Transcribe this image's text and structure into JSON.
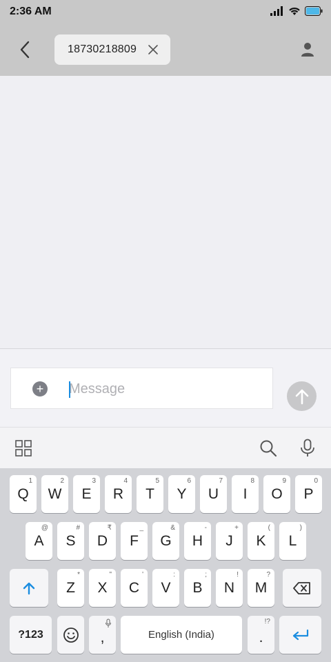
{
  "status_bar": {
    "time": "2:36 AM"
  },
  "header": {
    "recipient": "18730218809"
  },
  "composer": {
    "placeholder": "Message",
    "value": ""
  },
  "keyboard": {
    "row1": [
      {
        "key": "Q",
        "hint": "1"
      },
      {
        "key": "W",
        "hint": "2"
      },
      {
        "key": "E",
        "hint": "3"
      },
      {
        "key": "R",
        "hint": "4"
      },
      {
        "key": "T",
        "hint": "5"
      },
      {
        "key": "Y",
        "hint": "6"
      },
      {
        "key": "U",
        "hint": "7"
      },
      {
        "key": "I",
        "hint": "8"
      },
      {
        "key": "O",
        "hint": "9"
      },
      {
        "key": "P",
        "hint": "0"
      }
    ],
    "row2": [
      {
        "key": "A",
        "hint": "@"
      },
      {
        "key": "S",
        "hint": "#"
      },
      {
        "key": "D",
        "hint": "₹"
      },
      {
        "key": "F",
        "hint": "_"
      },
      {
        "key": "G",
        "hint": "&"
      },
      {
        "key": "H",
        "hint": "-"
      },
      {
        "key": "J",
        "hint": "+"
      },
      {
        "key": "K",
        "hint": "("
      },
      {
        "key": "L",
        "hint": ")"
      }
    ],
    "row3": [
      {
        "key": "Z",
        "hint": "*"
      },
      {
        "key": "X",
        "hint": "\""
      },
      {
        "key": "C",
        "hint": "'"
      },
      {
        "key": "V",
        "hint": ":"
      },
      {
        "key": "B",
        "hint": ";"
      },
      {
        "key": "N",
        "hint": "!"
      },
      {
        "key": "M",
        "hint": "?"
      }
    ],
    "symbols_label": "?123",
    "comma_label": ",",
    "space_label": "English (India)",
    "period_label": ".",
    "period_hint": "!?"
  },
  "colors": {
    "accent": "#1b8de0",
    "header_bg": "#c8c8c8",
    "keyboard_bg": "#d2d3d7"
  }
}
